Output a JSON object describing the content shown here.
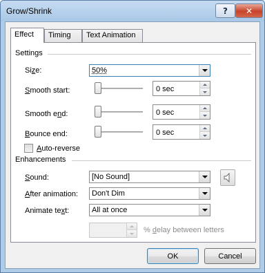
{
  "window": {
    "title": "Grow/Shrink",
    "help_glyph": "?",
    "close_glyph": "✕"
  },
  "tabs": [
    {
      "label": "Effect",
      "active": true
    },
    {
      "label": "Timing",
      "active": false
    },
    {
      "label": "Text Animation",
      "active": false
    }
  ],
  "settings": {
    "heading": "Settings",
    "size": {
      "label_pre": "Si",
      "label_u": "z",
      "label_post": "e:",
      "value": "50%"
    },
    "smooth_start": {
      "label_pre": "",
      "label_u": "S",
      "label_post": "mooth start:",
      "value": "0 sec"
    },
    "smooth_end": {
      "label_pre": "Smooth e",
      "label_u": "n",
      "label_post": "d:",
      "value": "0 sec"
    },
    "bounce_end": {
      "label_pre": "",
      "label_u": "B",
      "label_post": "ounce end:",
      "value": "0 sec"
    },
    "auto_reverse": {
      "label_pre": "",
      "label_u": "A",
      "label_post": "uto-reverse",
      "checked": false
    }
  },
  "enhancements": {
    "heading": "Enhancements",
    "sound": {
      "label_pre": "",
      "label_u": "S",
      "label_post": "ound:",
      "value": "[No Sound]"
    },
    "after_animation": {
      "label_pre": "",
      "label_u": "A",
      "label_post": "fter animation:",
      "value": "Don't Dim"
    },
    "animate_text": {
      "label_pre": "Animate te",
      "label_u": "x",
      "label_post": "t:",
      "value": "All at once"
    },
    "delay": {
      "value": "",
      "label_pre": "% ",
      "label_u": "d",
      "label_post": "elay between letters",
      "enabled": false
    }
  },
  "buttons": {
    "ok": "OK",
    "cancel": "Cancel"
  },
  "colors": {
    "accent": "#3c7fb1",
    "titlebar": "#aecbe8",
    "close": "#c8432b"
  },
  "icons": {
    "sound": "speaker-icon",
    "help": "help-icon",
    "close": "close-icon"
  }
}
